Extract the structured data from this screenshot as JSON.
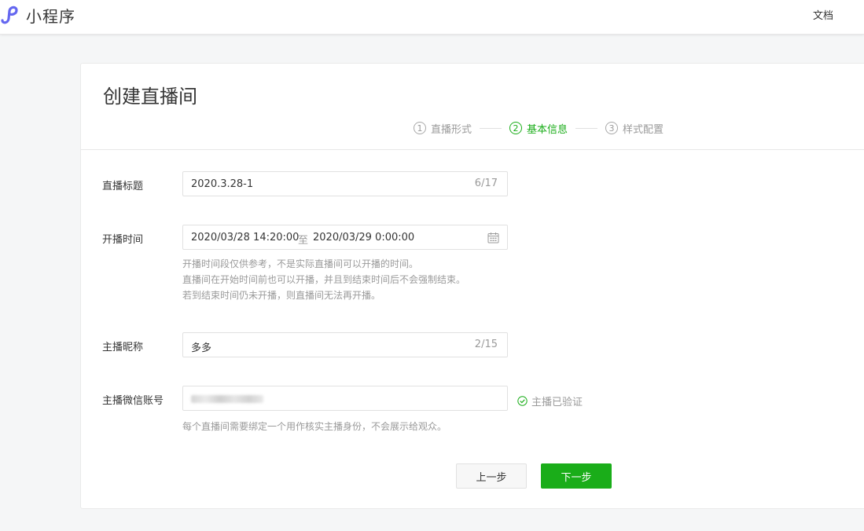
{
  "header": {
    "brand": "小程序",
    "docs_link": "文档"
  },
  "page": {
    "title": "创建直播间"
  },
  "steps": [
    {
      "num": "1",
      "label": "直播形式",
      "active": false
    },
    {
      "num": "2",
      "label": "基本信息",
      "active": true
    },
    {
      "num": "3",
      "label": "样式配置",
      "active": false
    }
  ],
  "form": {
    "title_label": "直播标题",
    "title_value": "2020.3.28-1",
    "title_count": "6/17",
    "time_label": "开播时间",
    "time_start": "2020/03/28 14:20:00",
    "time_sep": "至",
    "time_end": "2020/03/29 0:00:00",
    "time_hint": [
      "开播时间段仅供参考，不是实际直播间可以开播的时间。",
      "直播间在开始时间前也可以开播，并且到结束时间后不会强制结束。",
      "若到结束时间仍未开播，则直播间无法再开播。"
    ],
    "nickname_label": "主播昵称",
    "nickname_value": "多多",
    "nickname_count": "2/15",
    "wechat_label": "主播微信账号",
    "wechat_verified": "主播已验证",
    "wechat_hint": "每个直播间需要绑定一个用作核实主播身份，不会展示给观众。"
  },
  "buttons": {
    "prev": "上一步",
    "next": "下一步"
  },
  "colors": {
    "accent": "#1aad19",
    "brand_logo": "#6467f0"
  },
  "icons": {
    "logo": "miniprogram-logo-icon",
    "calendar": "calendar-icon",
    "verified": "check-circle-icon"
  }
}
